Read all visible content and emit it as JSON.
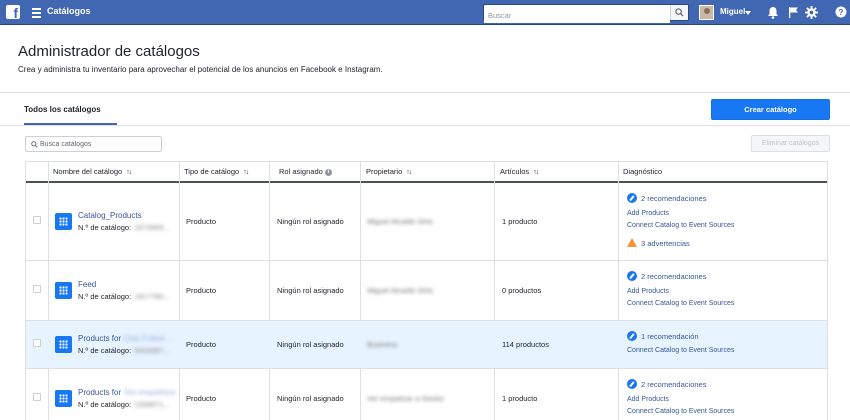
{
  "topbar": {
    "app_title": "Catálogos",
    "search_placeholder": "Buscar",
    "user_name": "Miguel",
    "icons": [
      "facebook-logo-icon",
      "menu-icon",
      "search-icon",
      "bell-icon",
      "flag-icon",
      "gear-icon",
      "help-icon"
    ]
  },
  "header": {
    "title": "Administrador de catálogos",
    "subtitle": "Crea y administra tu inventario para aprovechar el potencial de los anuncios en Facebook e Instagram."
  },
  "tabs": {
    "all_catalogs": "Todos los catálogos"
  },
  "actions": {
    "create_catalog": "Crear catálogo",
    "search_placeholder": "Busca catálogos",
    "delete_catalogs": "Eliminar catálogos"
  },
  "table": {
    "columns": {
      "name": "Nombre del catálogo",
      "type": "Tipo de catálogo",
      "role": "Rol asignado",
      "owner": "Propietario",
      "items": "Artículos",
      "diagnostics": "Diagnóstico"
    },
    "sort_glyph": "↑↓",
    "id_label": "N.º de catálogo:",
    "rows": [
      {
        "name": "Catalog_Products",
        "name_hidden": "",
        "id_hidden": "1674969...",
        "type": "Producto",
        "role": "Ningún rol asignado",
        "owner_hidden": "Miguel Alcalde Ortiz",
        "items": "1 producto",
        "diagnostics": [
          "2 recomendaciones",
          "Add Products",
          "Connect Catalog to Event Sources",
          "3 advertencias"
        ]
      },
      {
        "name": "Feed",
        "name_hidden": "",
        "id_hidden": "1817785...",
        "type": "Producto",
        "role": "Ningún rol asignado",
        "owner_hidden": "Miguel Alcalde Ortiz",
        "items": "0 productos",
        "diagnostics": [
          "2 recomendaciones",
          "Add Products",
          "Connect Catalog to Event Sources"
        ]
      },
      {
        "name": "Products for",
        "name_hidden": "Club Fútbol...",
        "id_hidden": "5004087...",
        "type": "Producto",
        "role": "Ningún rol asignado",
        "owner_hidden": "Business",
        "items": "114 productos",
        "diagnostics": [
          "1 recomendación",
          "Connect Catalog to Event Sources"
        ]
      },
      {
        "name": "Products for",
        "name_hidden": "Yes empathize...",
        "id_hidden": "1558871...",
        "type": "Producto",
        "role": "Ningún rol asignado",
        "owner_hidden": "Ver empatizar a Gestor",
        "items": "1 producto",
        "diagnostics": [
          "2 recomendaciones",
          "Add Products",
          "Connect Catalog to Event Sources"
        ]
      }
    ]
  }
}
